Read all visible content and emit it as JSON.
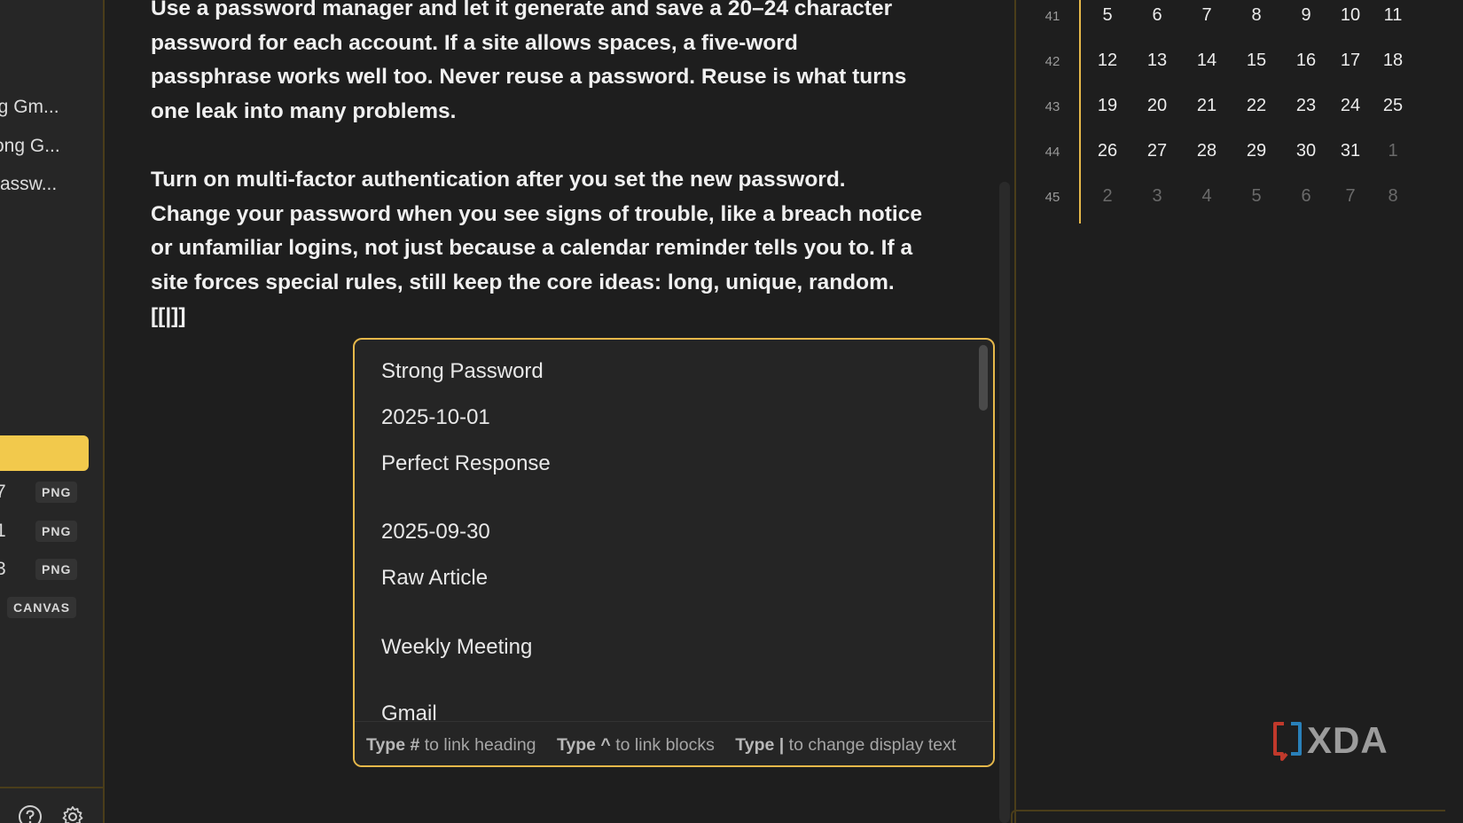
{
  "sidebar": {
    "files": [
      {
        "label": "ng Gm..."
      },
      {
        "label": "rong G..."
      },
      {
        "label": " Passw..."
      }
    ],
    "attachments": [
      {
        "num": "7",
        "type": "PNG"
      },
      {
        "num": "1",
        "type": "PNG"
      },
      {
        "num": "3",
        "type": "PNG"
      },
      {
        "num": "",
        "type": "CANVAS"
      }
    ],
    "footer": {
      "help_icon": "help-circle-icon",
      "settings_icon": "gear-icon"
    }
  },
  "editor": {
    "paragraph1": "Use a password manager and let it generate and save a 20–24 character password for each account. If a site allows spaces, a five-word passphrase works well too. Never reuse a password. Reuse is what turns one leak into many problems.",
    "paragraph2_text": "Turn on multi-factor authentication after you set the new password. Change your password when you see signs of trouble, like a breach notice or unfamiliar logins, not just because a calendar reminder tells you to. If a site forces special rules, still keep the core ideas: long, unique, random. ",
    "paragraph2_link_token": "[[|]]"
  },
  "link_popup": {
    "suggestions": [
      "Strong Password",
      "2025-10-01",
      "Perfect Response",
      "2025-09-30",
      "Raw Article",
      "Weekly Meeting",
      "Gmail"
    ],
    "hints": [
      {
        "key": "Type #",
        "text": " to link heading"
      },
      {
        "key": "Type ^",
        "text": " to link blocks"
      },
      {
        "key": "Type |",
        "text": " to change display text"
      }
    ]
  },
  "calendar": {
    "weeks": [
      {
        "num": "41",
        "days": [
          "5",
          "6",
          "7",
          "8",
          "9",
          "10",
          "11"
        ],
        "muted": [
          false,
          false,
          false,
          false,
          false,
          false,
          false
        ]
      },
      {
        "num": "42",
        "days": [
          "12",
          "13",
          "14",
          "15",
          "16",
          "17",
          "18"
        ],
        "muted": [
          false,
          false,
          false,
          false,
          false,
          false,
          false
        ]
      },
      {
        "num": "43",
        "days": [
          "19",
          "20",
          "21",
          "22",
          "23",
          "24",
          "25"
        ],
        "muted": [
          false,
          false,
          false,
          false,
          false,
          false,
          false
        ]
      },
      {
        "num": "44",
        "days": [
          "26",
          "27",
          "28",
          "29",
          "30",
          "31",
          "1"
        ],
        "muted": [
          false,
          false,
          false,
          false,
          false,
          false,
          true
        ]
      },
      {
        "num": "45",
        "days": [
          "2",
          "3",
          "4",
          "5",
          "6",
          "7",
          "8"
        ],
        "muted": [
          true,
          true,
          true,
          true,
          true,
          true,
          true
        ]
      }
    ]
  },
  "watermark": {
    "text": "XDA"
  },
  "colors": {
    "accent": "#e6b84a",
    "highlight": "#f2c94c",
    "background": "#1e1e1e"
  }
}
